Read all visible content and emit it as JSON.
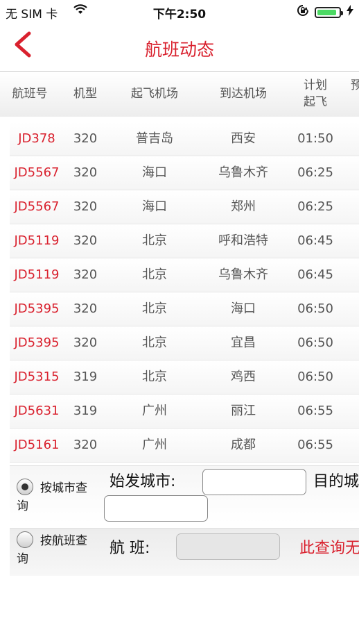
{
  "status_bar": {
    "carrier": "无 SIM 卡",
    "time": "下午2:50",
    "battery_level": 0.9
  },
  "nav": {
    "title": "航班动态",
    "back_icon": "chevron-left-icon"
  },
  "table": {
    "headers": {
      "flight_no": "航班号",
      "aircraft": "机型",
      "departure": "起飞机场",
      "arrival": "到达机场",
      "scheduled_line1": "计划",
      "scheduled_line2": "起飞",
      "cut_off": "预"
    },
    "rows": [
      {
        "flight": "JD378",
        "aircraft": "320",
        "from": "普吉岛",
        "to": "西安",
        "time": "01:50"
      },
      {
        "flight": "JD5567",
        "aircraft": "320",
        "from": "海口",
        "to": "乌鲁木齐",
        "time": "06:25"
      },
      {
        "flight": "JD5567",
        "aircraft": "320",
        "from": "海口",
        "to": "郑州",
        "time": "06:25"
      },
      {
        "flight": "JD5119",
        "aircraft": "320",
        "from": "北京",
        "to": "呼和浩特",
        "time": "06:45"
      },
      {
        "flight": "JD5119",
        "aircraft": "320",
        "from": "北京",
        "to": "乌鲁木齐",
        "time": "06:45"
      },
      {
        "flight": "JD5395",
        "aircraft": "320",
        "from": "北京",
        "to": "海口",
        "time": "06:50"
      },
      {
        "flight": "JD5395",
        "aircraft": "320",
        "from": "北京",
        "to": "宜昌",
        "time": "06:50"
      },
      {
        "flight": "JD5315",
        "aircraft": "319",
        "from": "北京",
        "to": "鸡西",
        "time": "06:50"
      },
      {
        "flight": "JD5631",
        "aircraft": "319",
        "from": "广州",
        "to": "丽江",
        "time": "06:55"
      },
      {
        "flight": "JD5161",
        "aircraft": "320",
        "from": "广州",
        "to": "成都",
        "time": "06:55"
      }
    ]
  },
  "query": {
    "by_city": {
      "label_line1": "按城市查",
      "label_line2": "询",
      "selected": true,
      "origin_label": "始发城市:",
      "origin_value": "",
      "dest_label": "目的城",
      "dest_value": ""
    },
    "by_flight": {
      "label_line1": "按航班查",
      "label_line2": "询",
      "selected": false,
      "flight_label": "航 班:",
      "flight_value": "",
      "note": "此查询无"
    }
  },
  "colors": {
    "accent": "#d9212e",
    "battery": "#4cd964"
  }
}
